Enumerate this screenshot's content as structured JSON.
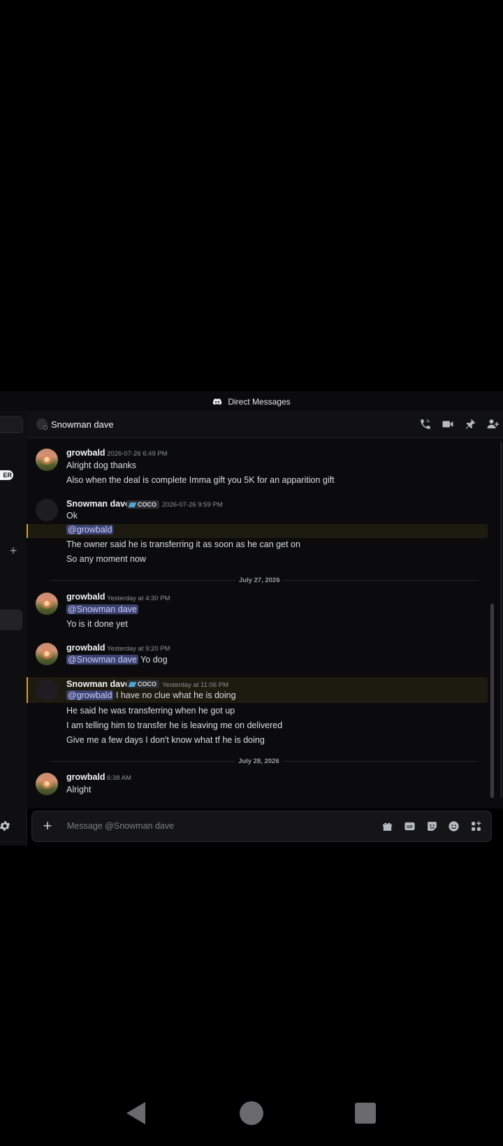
{
  "app": {
    "title": "Direct Messages"
  },
  "leftstrip": {
    "badge": "ER"
  },
  "header": {
    "dm_name": "Snowman dave"
  },
  "messages": [
    {
      "user": "growbald",
      "timestamp": "2026-07-26 6:49 PM",
      "lines": [
        "Alright dog thanks",
        "Also when the deal is complete Imma gift you 5K for an apparition gift"
      ]
    },
    {
      "user": "Snowman dave",
      "tag": "COCO",
      "timestamp": "2026-07-26 9:59 PM",
      "line1": "Ok",
      "mention": "@growbald",
      "lines": [
        "The owner said he is transferring it as soon as he can get on",
        "So any moment now"
      ]
    },
    {
      "user": "growbald",
      "timestamp": "Yesterday at 4:30 PM",
      "mention": "@Snowman dave",
      "lines": [
        "Yo is it done yet"
      ]
    },
    {
      "user": "growbald",
      "timestamp": "Yesterday at 9:20 PM",
      "mention": "@Snowman dave",
      "after_mention": "Yo dog"
    },
    {
      "user": "Snowman dave",
      "tag": "COCO",
      "timestamp": "Yesterday at 11:06 PM",
      "mention": "@growbald",
      "after_mention": "I have no clue what he is doing",
      "lines": [
        "He said he was transferring when he got up",
        "I am telling him to transfer he is leaving me on delivered",
        "Give me a few days I don't know what tf he is doing"
      ]
    },
    {
      "user": "growbald",
      "timestamp": "6:38 AM",
      "lines": [
        "Alright"
      ]
    }
  ],
  "dividers": [
    "July 27, 2026",
    "July 28, 2026"
  ],
  "composer": {
    "placeholder": "Message @Snowman dave"
  },
  "icons": [
    "discord-icon",
    "phone-icon",
    "video-icon",
    "pin-icon",
    "add-user-icon",
    "gift-icon",
    "gif-icon",
    "sticker-icon",
    "emoji-icon",
    "apps-icon",
    "gear-icon",
    "plus-icon"
  ]
}
